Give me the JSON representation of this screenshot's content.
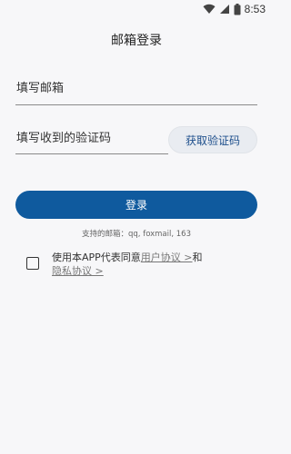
{
  "status_bar": {
    "time": "8:53",
    "icons": [
      "wifi-icon",
      "signal-icon",
      "battery-icon"
    ]
  },
  "page": {
    "title": "邮箱登录"
  },
  "form": {
    "email_placeholder": "填写邮箱",
    "code_placeholder": "填写收到的验证码",
    "get_code_label": "获取验证码",
    "login_label": "登录",
    "supported_hint": "支持的邮箱：qq, foxmail, 163"
  },
  "agreement": {
    "checked": false,
    "prefix": "使用本APP代表同意",
    "user_agreement_link": "用户协议 >",
    "conjunction": "和",
    "privacy_link": "隐私协议 >"
  },
  "colors": {
    "primary": "#0f5a9e",
    "background": "#f7f7f9",
    "secondary_button": "#e9ecf1"
  }
}
